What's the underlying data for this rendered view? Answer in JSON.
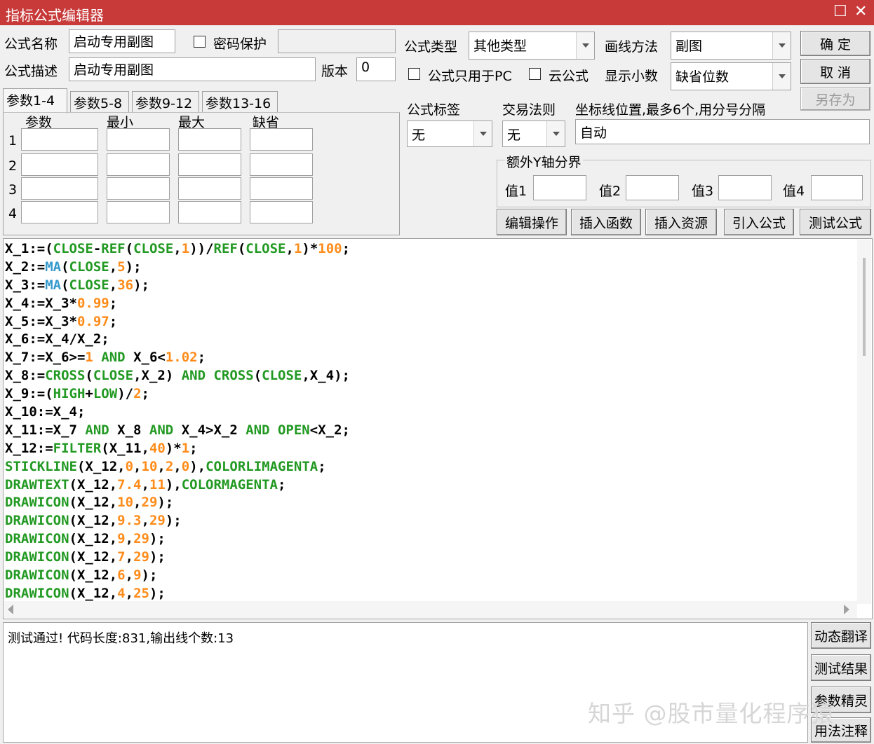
{
  "window": {
    "title": "指标公式编辑器",
    "maximize_glyph": "☐",
    "close_glyph": "✕"
  },
  "form": {
    "name_label": "公式名称",
    "name_value": "启动专用副图",
    "password_label": "密码保护",
    "desc_label": "公式描述",
    "desc_value": "启动专用副图",
    "version_label": "版本",
    "version_value": "0",
    "type_label": "公式类型",
    "type_value": "其他类型",
    "draw_label": "画线方法",
    "draw_value": "副图",
    "pc_only_label": "公式只用于PC",
    "cloud_label": "云公式",
    "decimals_label": "显示小数",
    "decimals_value": "缺省位数",
    "tag_label": "公式标签",
    "tag_value": "无",
    "trade_label": "交易法则",
    "trade_value": "无",
    "coord_label": "坐标线位置,最多6个,用分号分隔",
    "coord_value": "自动",
    "yaxis_group": "额外Y轴分界",
    "y_labels": [
      "值1",
      "值2",
      "值3",
      "值4"
    ]
  },
  "buttons": {
    "ok": "确  定",
    "cancel": "取  消",
    "save_as": "另存为",
    "edit_ops": "编辑操作",
    "insert_func": "插入函数",
    "insert_res": "插入资源",
    "import_formula": "引入公式",
    "test_formula": "测试公式",
    "dyn_translate": "动态翻译",
    "test_result": "测试结果",
    "param_wizard": "参数精灵",
    "usage_note": "用法注释"
  },
  "tabs": [
    "参数1-4",
    "参数5-8",
    "参数9-12",
    "参数13-16"
  ],
  "params": {
    "headers": [
      "参数",
      "最小",
      "最大",
      "缺省"
    ],
    "rows": [
      "1",
      "2",
      "3",
      "4"
    ]
  },
  "code_lines": [
    "X_1:=(CLOSE-REF(CLOSE,1))/REF(CLOSE,1)*100;",
    "X_2:=MA(CLOSE,5);",
    "X_3:=MA(CLOSE,36);",
    "X_4:=X_3*0.99;",
    "X_5:=X_3*0.97;",
    "X_6:=X_4/X_2;",
    "X_7:=X_6>=1 AND X_6<1.02;",
    "X_8:=CROSS(CLOSE,X_2) AND CROSS(CLOSE,X_4);",
    "X_9:=(HIGH+LOW)/2;",
    "X_10:=X_4;",
    "X_11:=X_7 AND X_8 AND X_4>X_2 AND OPEN<X_2;",
    "X_12:=FILTER(X_11,40)*1;",
    "STICKLINE(X_12,0,10,2,0),COLORLIMAGENTA;",
    "DRAWTEXT(X_12,7.4,11),COLORMAGENTA;",
    "DRAWICON(X_12,10,29);",
    "DRAWICON(X_12,9.3,29);",
    "DRAWICON(X_12,9,29);",
    "DRAWICON(X_12,7,29);",
    "DRAWICON(X_12,6,9);",
    "DRAWICON(X_12,4,25);"
  ],
  "output_text": "测试通过! 代码长度:831,输出线个数:13",
  "watermark": "知乎 @股市量化程序猿",
  "colors": {
    "title_bar": "#c83a3a",
    "function": "#229922",
    "number": "#ff8c1a",
    "ma": "#3399cc"
  }
}
